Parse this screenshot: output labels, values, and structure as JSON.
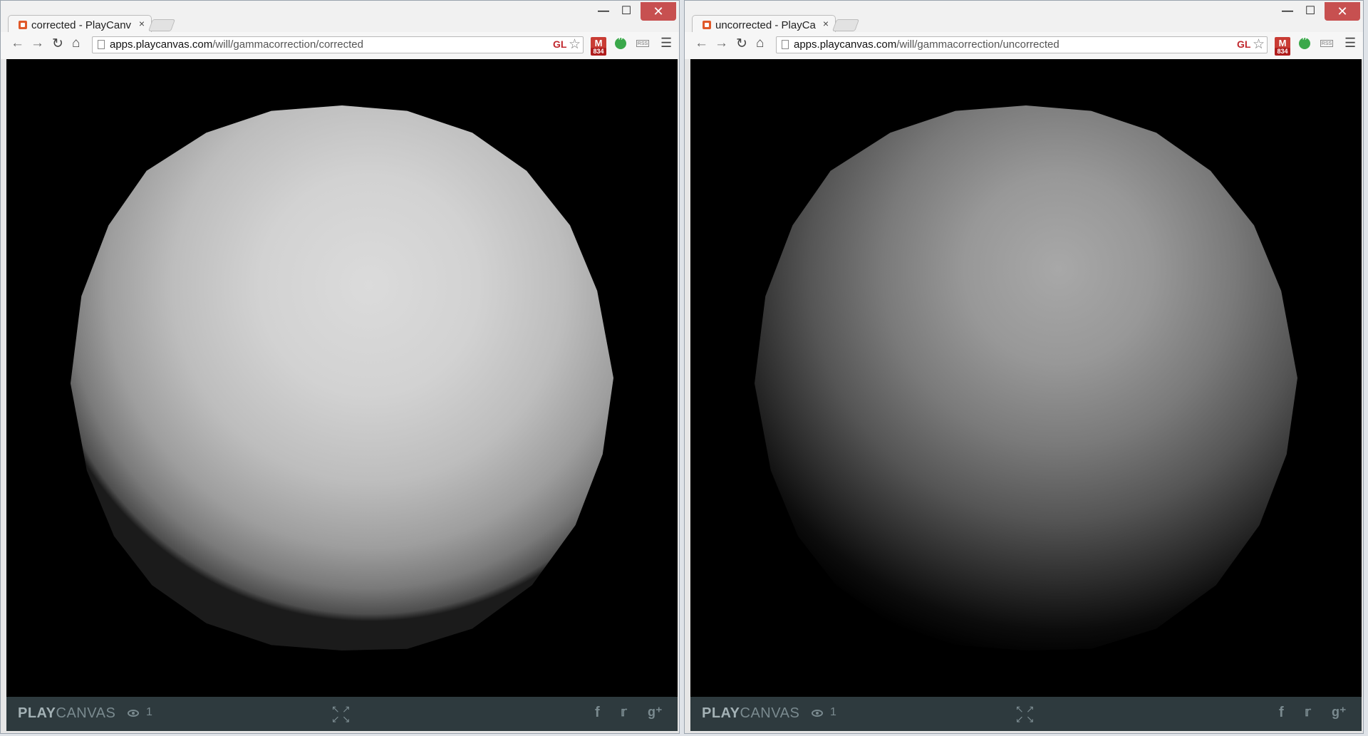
{
  "windows": [
    {
      "tab_title": "corrected - PlayCanv",
      "tab_close": "×",
      "url_host": "apps.playcanvas.com",
      "url_path": "/will/gammacorrection/corrected",
      "gl_label": "GL",
      "gmail_badge": "834",
      "render": "corrected",
      "brand_strong": "PLAY",
      "brand_light": "CANVAS",
      "viewer_count": "1"
    },
    {
      "tab_title": "uncorrected - PlayCa",
      "tab_close": "×",
      "url_host": "apps.playcanvas.com",
      "url_path": "/will/gammacorrection/uncorrected",
      "gl_label": "GL",
      "gmail_badge": "834",
      "render": "uncorrected",
      "brand_strong": "PLAY",
      "brand_light": "CANVAS",
      "viewer_count": "1"
    }
  ],
  "window_controls": {
    "minimize": "—",
    "maximize": "☐",
    "close": "✕"
  },
  "icons": {
    "back": "back-arrow-icon",
    "forward": "forward-arrow-icon",
    "reload": "reload-icon",
    "home": "home-icon",
    "star": "bookmark-star-icon",
    "menu": "menu-icon",
    "facebook": "facebook-icon",
    "twitter": "twitter-icon",
    "gplus": "google-plus-icon",
    "fullscreen": "fullscreen-icon",
    "eye": "viewers-eye-icon"
  },
  "colors": {
    "close_button": "#c75050",
    "playcanvas_bar": "#2e3a3e",
    "gl_label": "#c0272d",
    "gmail": "#c93c34",
    "hangouts": "#3aa84a"
  }
}
